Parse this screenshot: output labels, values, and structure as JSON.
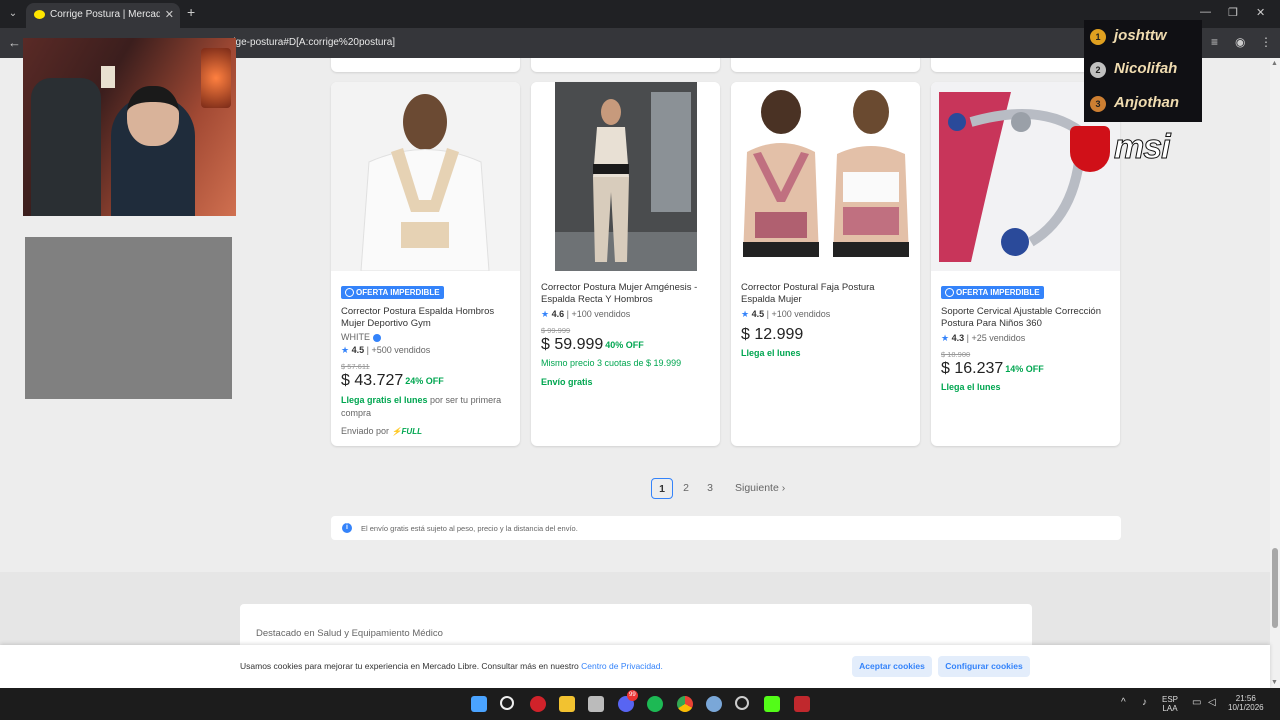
{
  "browser": {
    "tab_title": "Corrige Postura | MercadoLibre",
    "tab_close": "✕",
    "new_tab": "+",
    "url_visible": "rige-postura#D[A:corrige%20postura]",
    "window_controls": [
      "—",
      "❐",
      "✕"
    ]
  },
  "products": [
    {
      "badge": "OFERTA IMPERDIBLE",
      "title": "Corrector Postura Espalda Hombros Mujer Deportivo Gym",
      "brand": "WHITE",
      "rating": "4.5",
      "sold": "+500 vendidos",
      "old_price": "$ 57.611",
      "price": "$ 43.727",
      "discount": "24% OFF",
      "shipping": "Llega gratis el lunes",
      "shipping_note": "por ser tu primera compra",
      "sent_by": "Enviado por",
      "full": "FULL"
    },
    {
      "title": "Corrector Postura Mujer Amgénesis - Espalda Recta Y Hombros",
      "rating": "4.6",
      "sold": "+100 vendidos",
      "old_price": "$ 99.999",
      "price": "$ 59.999",
      "discount": "40% OFF",
      "installments": "Mismo precio 3 cuotas de $ 19.999",
      "shipping": "Envío gratis"
    },
    {
      "title": "Corrector Postural Faja Postura Espalda Mujer",
      "rating": "4.5",
      "sold": "+100 vendidos",
      "price": "$ 12.999",
      "shipping": "Llega el lunes"
    },
    {
      "badge": "OFERTA IMPERDIBLE",
      "title": "Soporte Cervical Ajustable Corrección Postura Para Niños 360",
      "rating": "4.3",
      "sold": "+25 vendidos",
      "old_price": "$ 18.900",
      "price": "$ 16.237",
      "discount": "14% OFF",
      "shipping": "Llega el lunes"
    }
  ],
  "pagination": {
    "pages": [
      "1",
      "2",
      "3"
    ],
    "current": "1",
    "next": "Siguiente"
  },
  "notice": "El envío gratis está sujeto al peso, precio y la distancia del envío.",
  "featured": "Destacado en Salud y Equipamiento Médico",
  "cookies": {
    "text": "Usamos cookies para mejorar tu experiencia en Mercado Libre. Consultar más en nuestro",
    "link": "Centro de Privacidad.",
    "accept": "Aceptar cookies",
    "configure": "Configurar cookies"
  },
  "overlay": {
    "donors": [
      {
        "rank": "1",
        "name": "joshttw"
      },
      {
        "rank": "2",
        "name": "Nicolifah"
      },
      {
        "rank": "3",
        "name": "Anjothan"
      }
    ],
    "sponsor": "msi"
  },
  "taskbar": {
    "lang": "ESP",
    "layout": "LAA",
    "time": "21:56",
    "date": "10/1/2026",
    "badge_count": "99"
  },
  "colors": {
    "accent": "#3483fa",
    "green": "#00a650",
    "brand_yellow": "#ffe600"
  }
}
